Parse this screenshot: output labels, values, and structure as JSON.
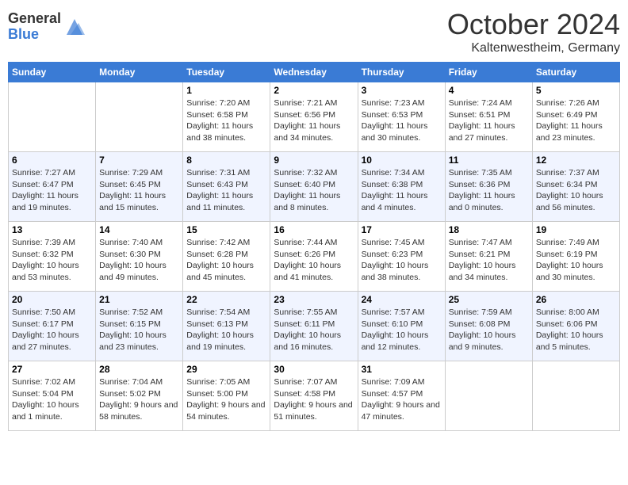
{
  "header": {
    "logo_general": "General",
    "logo_blue": "Blue",
    "month_title": "October 2024",
    "location": "Kaltenwestheim, Germany"
  },
  "weekdays": [
    "Sunday",
    "Monday",
    "Tuesday",
    "Wednesday",
    "Thursday",
    "Friday",
    "Saturday"
  ],
  "weeks": [
    [
      {
        "day": "",
        "info": ""
      },
      {
        "day": "",
        "info": ""
      },
      {
        "day": "1",
        "info": "Sunrise: 7:20 AM\nSunset: 6:58 PM\nDaylight: 11 hours and 38 minutes."
      },
      {
        "day": "2",
        "info": "Sunrise: 7:21 AM\nSunset: 6:56 PM\nDaylight: 11 hours and 34 minutes."
      },
      {
        "day": "3",
        "info": "Sunrise: 7:23 AM\nSunset: 6:53 PM\nDaylight: 11 hours and 30 minutes."
      },
      {
        "day": "4",
        "info": "Sunrise: 7:24 AM\nSunset: 6:51 PM\nDaylight: 11 hours and 27 minutes."
      },
      {
        "day": "5",
        "info": "Sunrise: 7:26 AM\nSunset: 6:49 PM\nDaylight: 11 hours and 23 minutes."
      }
    ],
    [
      {
        "day": "6",
        "info": "Sunrise: 7:27 AM\nSunset: 6:47 PM\nDaylight: 11 hours and 19 minutes."
      },
      {
        "day": "7",
        "info": "Sunrise: 7:29 AM\nSunset: 6:45 PM\nDaylight: 11 hours and 15 minutes."
      },
      {
        "day": "8",
        "info": "Sunrise: 7:31 AM\nSunset: 6:43 PM\nDaylight: 11 hours and 11 minutes."
      },
      {
        "day": "9",
        "info": "Sunrise: 7:32 AM\nSunset: 6:40 PM\nDaylight: 11 hours and 8 minutes."
      },
      {
        "day": "10",
        "info": "Sunrise: 7:34 AM\nSunset: 6:38 PM\nDaylight: 11 hours and 4 minutes."
      },
      {
        "day": "11",
        "info": "Sunrise: 7:35 AM\nSunset: 6:36 PM\nDaylight: 11 hours and 0 minutes."
      },
      {
        "day": "12",
        "info": "Sunrise: 7:37 AM\nSunset: 6:34 PM\nDaylight: 10 hours and 56 minutes."
      }
    ],
    [
      {
        "day": "13",
        "info": "Sunrise: 7:39 AM\nSunset: 6:32 PM\nDaylight: 10 hours and 53 minutes."
      },
      {
        "day": "14",
        "info": "Sunrise: 7:40 AM\nSunset: 6:30 PM\nDaylight: 10 hours and 49 minutes."
      },
      {
        "day": "15",
        "info": "Sunrise: 7:42 AM\nSunset: 6:28 PM\nDaylight: 10 hours and 45 minutes."
      },
      {
        "day": "16",
        "info": "Sunrise: 7:44 AM\nSunset: 6:26 PM\nDaylight: 10 hours and 41 minutes."
      },
      {
        "day": "17",
        "info": "Sunrise: 7:45 AM\nSunset: 6:23 PM\nDaylight: 10 hours and 38 minutes."
      },
      {
        "day": "18",
        "info": "Sunrise: 7:47 AM\nSunset: 6:21 PM\nDaylight: 10 hours and 34 minutes."
      },
      {
        "day": "19",
        "info": "Sunrise: 7:49 AM\nSunset: 6:19 PM\nDaylight: 10 hours and 30 minutes."
      }
    ],
    [
      {
        "day": "20",
        "info": "Sunrise: 7:50 AM\nSunset: 6:17 PM\nDaylight: 10 hours and 27 minutes."
      },
      {
        "day": "21",
        "info": "Sunrise: 7:52 AM\nSunset: 6:15 PM\nDaylight: 10 hours and 23 minutes."
      },
      {
        "day": "22",
        "info": "Sunrise: 7:54 AM\nSunset: 6:13 PM\nDaylight: 10 hours and 19 minutes."
      },
      {
        "day": "23",
        "info": "Sunrise: 7:55 AM\nSunset: 6:11 PM\nDaylight: 10 hours and 16 minutes."
      },
      {
        "day": "24",
        "info": "Sunrise: 7:57 AM\nSunset: 6:10 PM\nDaylight: 10 hours and 12 minutes."
      },
      {
        "day": "25",
        "info": "Sunrise: 7:59 AM\nSunset: 6:08 PM\nDaylight: 10 hours and 9 minutes."
      },
      {
        "day": "26",
        "info": "Sunrise: 8:00 AM\nSunset: 6:06 PM\nDaylight: 10 hours and 5 minutes."
      }
    ],
    [
      {
        "day": "27",
        "info": "Sunrise: 7:02 AM\nSunset: 5:04 PM\nDaylight: 10 hours and 1 minute."
      },
      {
        "day": "28",
        "info": "Sunrise: 7:04 AM\nSunset: 5:02 PM\nDaylight: 9 hours and 58 minutes."
      },
      {
        "day": "29",
        "info": "Sunrise: 7:05 AM\nSunset: 5:00 PM\nDaylight: 9 hours and 54 minutes."
      },
      {
        "day": "30",
        "info": "Sunrise: 7:07 AM\nSunset: 4:58 PM\nDaylight: 9 hours and 51 minutes."
      },
      {
        "day": "31",
        "info": "Sunrise: 7:09 AM\nSunset: 4:57 PM\nDaylight: 9 hours and 47 minutes."
      },
      {
        "day": "",
        "info": ""
      },
      {
        "day": "",
        "info": ""
      }
    ]
  ]
}
